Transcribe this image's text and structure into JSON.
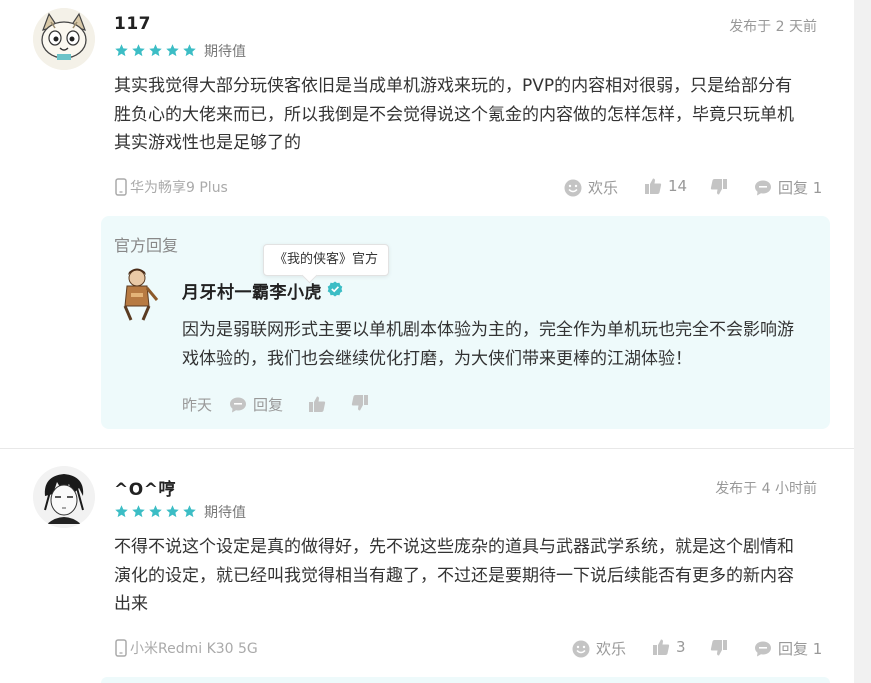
{
  "comments": [
    {
      "username": "117",
      "rating_stars": 5,
      "rating_label": "期待值",
      "posted": "发布于 2 天前",
      "body_lines": [
        "其实我觉得大部分玩侠客依旧是当成单机游戏来玩的，PVP的内容相对很弱，只是给部分有",
        "胜负心的大佬来而已，所以我倒是不会觉得说这个氪金的内容做的怎样怎样，毕竟只玩单机",
        "其实游戏性也是足够了的"
      ],
      "device": "华为畅享9 Plus",
      "fun_label": "欢乐",
      "likes": "14",
      "reply_label": "回复 1"
    },
    {
      "username": "^O^哼",
      "rating_stars": 5,
      "rating_label": "期待值",
      "posted": "发布于 4 小时前",
      "body_lines": [
        "不得不说这个设定是真的做得好，先不说这些庞杂的道具与武器武学系统，就是这个剧情和",
        "演化的设定，就已经叫我觉得相当有趣了，不过还是要期待一下说后续能否有更多的新内容",
        "出来"
      ],
      "device": "小米Redmi K30 5G",
      "fun_label": "欢乐",
      "likes": "3",
      "reply_label": "回复 1"
    }
  ],
  "official_reply": {
    "section_label": "官方回复",
    "tooltip": "《我的侠客》官方",
    "author": "月牙村一霸李小虎",
    "body_lines": [
      "因为是弱联网形式主要以单机剧本体验为主的，完全作为单机玩也完全不会影响游",
      "戏体验的，我们也会继续优化打磨，为大侠们带来更棒的江湖体验！"
    ],
    "time": "昨天",
    "reply_label": "回复"
  },
  "colors": {
    "star": "#3cbdc5",
    "verified": "#3cbdc5",
    "reply_bg": "#eefafb",
    "muted": "#999999"
  },
  "icons": [
    "phone-icon",
    "smile-icon",
    "thumbs-up-icon",
    "thumbs-down-icon",
    "chat-bubble-icon",
    "verified-badge-icon",
    "star-icon"
  ]
}
